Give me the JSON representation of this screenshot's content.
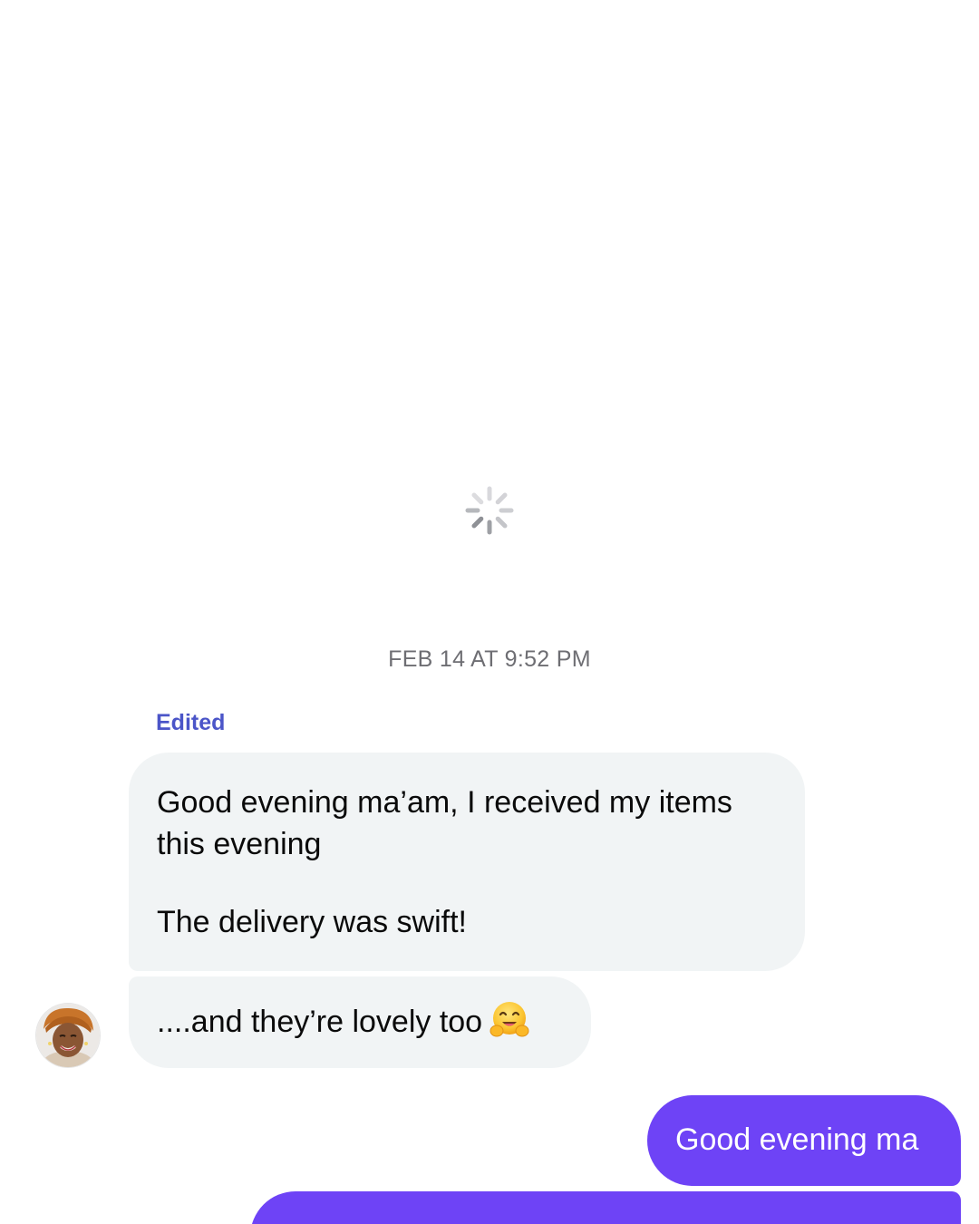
{
  "conversation": {
    "timestamp": "FEB 14 AT 9:52 PM",
    "loading_indicator": "spinner-icon",
    "incoming": {
      "edited_label": "Edited",
      "message_1_line_1": "Good evening ma’am, I received my items this evening",
      "message_1_line_2": "The delivery was swift!",
      "message_2": "....and they’re lovely too",
      "message_2_emoji": "hugging-face-emoji",
      "avatar": "avatar"
    },
    "outgoing": {
      "message_1": "Good evening ma"
    }
  },
  "colors": {
    "background": "#ffffff",
    "incoming_bubble": "#f1f4f5",
    "outgoing_bubble": "#6e43f6",
    "timestamp_text": "#6e6e73",
    "edited_text": "#4b55c8"
  }
}
